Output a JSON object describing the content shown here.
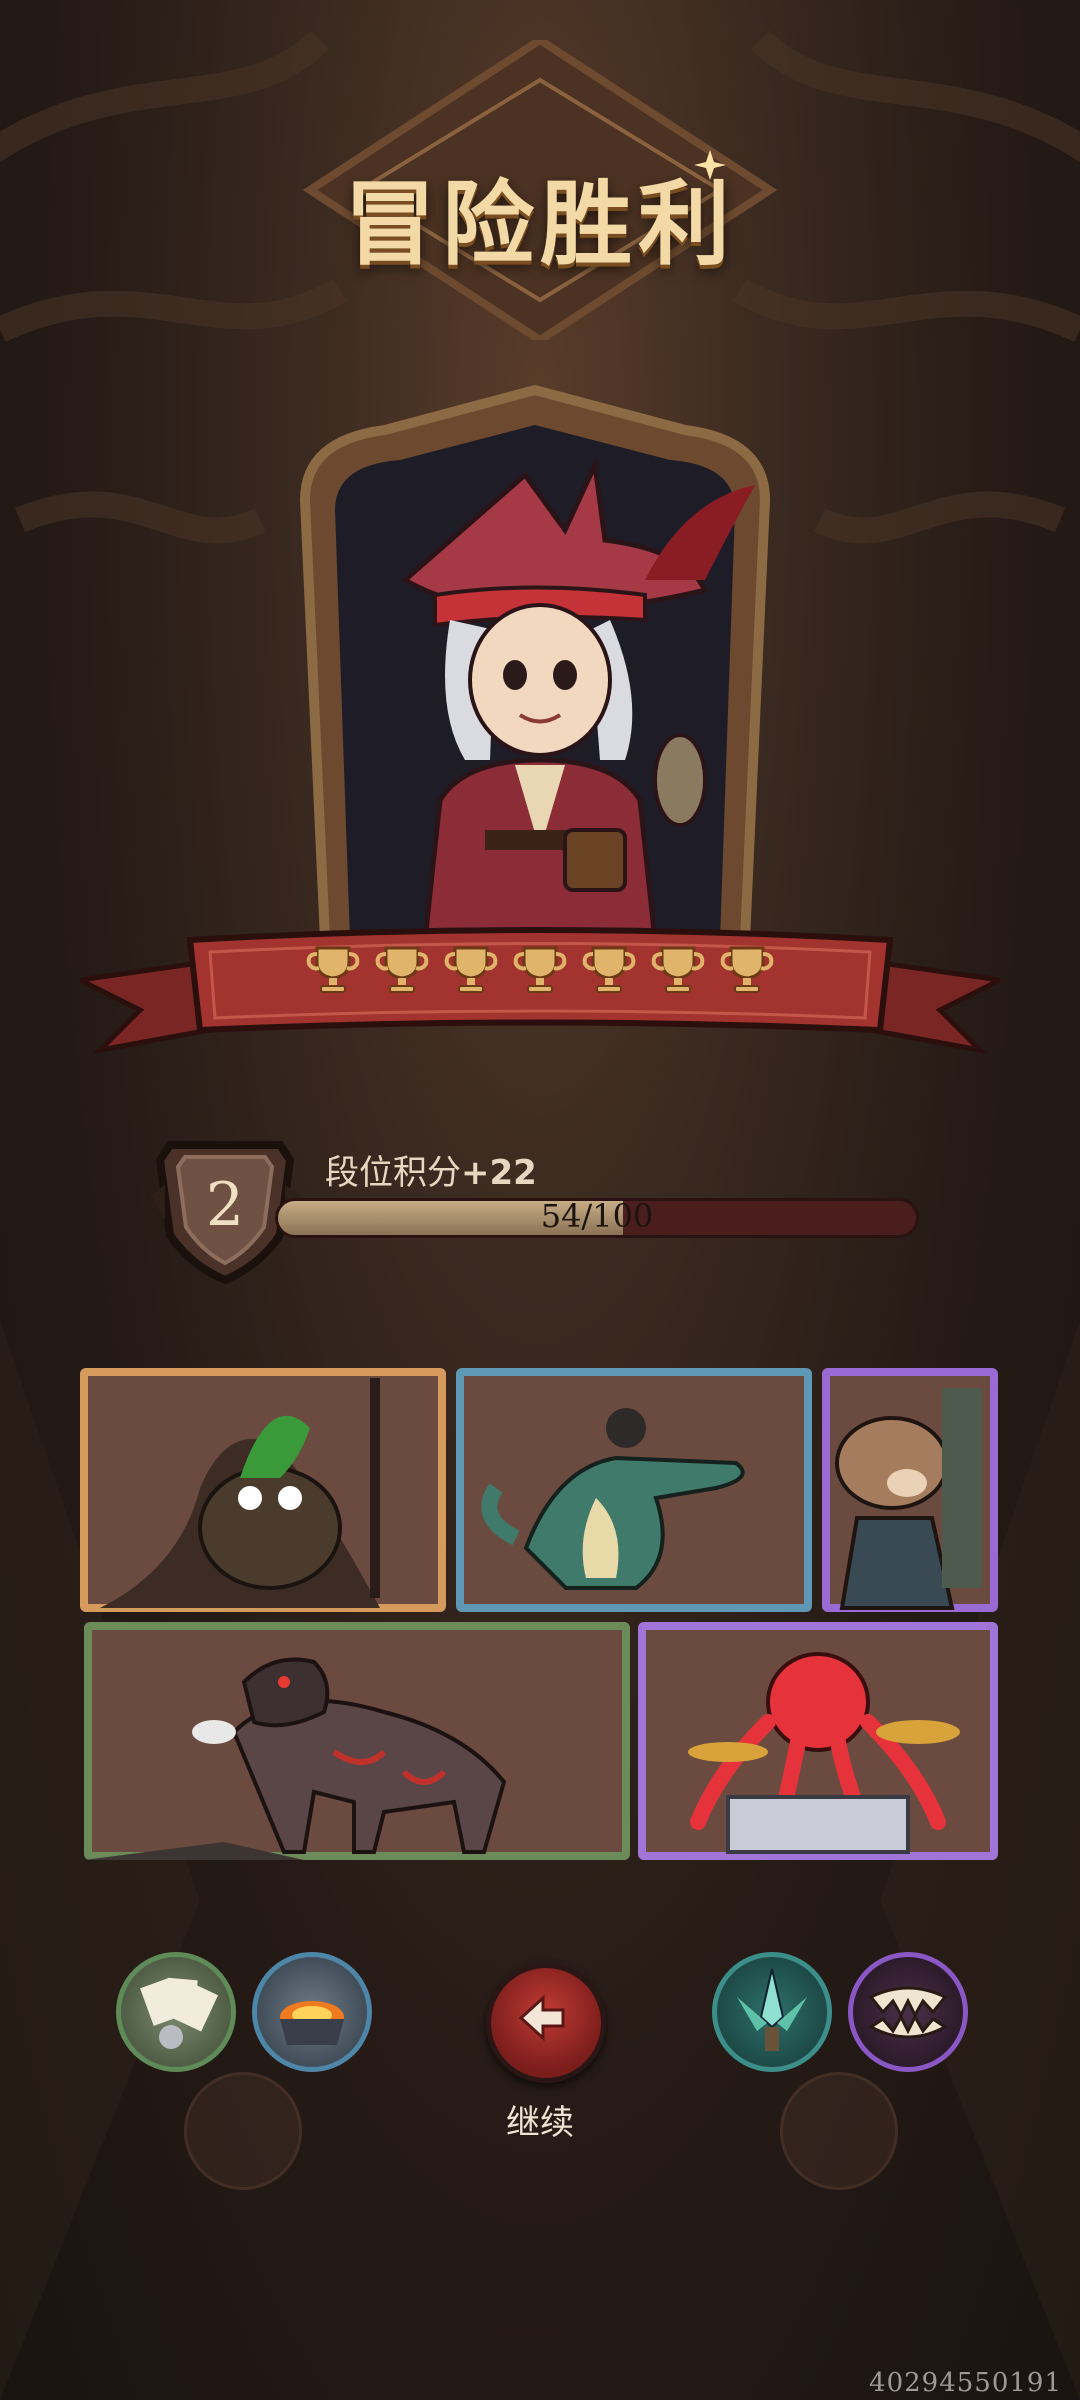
{
  "screen": {
    "title": "冒险胜利",
    "trophy_count": 7,
    "rank": {
      "level": "2",
      "label": "段位积分",
      "gain": "+22",
      "progress_text": "54/100",
      "progress": 0.54
    },
    "monster_cards": [
      {
        "name": "owl-shaman-card",
        "border": "#d69a5c"
      },
      {
        "name": "crocodile-card",
        "border": "#5f98b4"
      },
      {
        "name": "rat-miner-card",
        "border": "#9a6ad4"
      },
      {
        "name": "wildebeest-card",
        "border": "#6b8c58"
      },
      {
        "name": "octopus-drummer-card",
        "border": "#a174d8"
      }
    ],
    "skills_left": [
      "card-hand-skill-icon",
      "fire-cauldron-skill-icon"
    ],
    "skills_right": [
      "green-blade-skill-icon",
      "purple-fang-skill-icon"
    ],
    "continue_label": "继续",
    "footer_code": "40294550191"
  },
  "colors": {
    "accent_red": "#a8302c",
    "gold": "#e0b46a",
    "title": "#f3d9a6"
  }
}
